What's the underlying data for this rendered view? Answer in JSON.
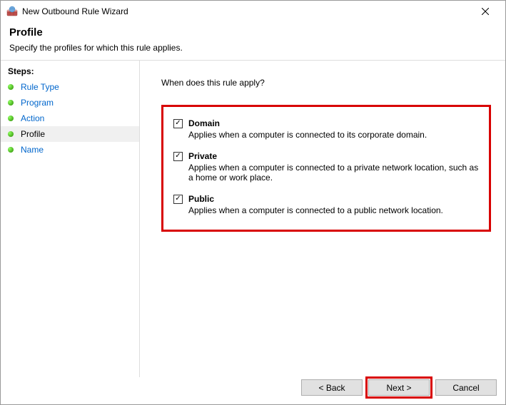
{
  "window": {
    "title": "New Outbound Rule Wizard"
  },
  "header": {
    "title": "Profile",
    "description": "Specify the profiles for which this rule applies."
  },
  "sidebar": {
    "title": "Steps:",
    "steps": [
      {
        "label": "Rule Type",
        "current": false
      },
      {
        "label": "Program",
        "current": false
      },
      {
        "label": "Action",
        "current": false
      },
      {
        "label": "Profile",
        "current": true
      },
      {
        "label": "Name",
        "current": false
      }
    ]
  },
  "content": {
    "question": "When does this rule apply?",
    "profiles": [
      {
        "label": "Domain",
        "checked": true,
        "desc": "Applies when a computer is connected to its corporate domain."
      },
      {
        "label": "Private",
        "checked": true,
        "desc": "Applies when a computer is connected to a private network location, such as a home or work place."
      },
      {
        "label": "Public",
        "checked": true,
        "desc": "Applies when a computer is connected to a public network location."
      }
    ]
  },
  "buttons": {
    "back": "< Back",
    "next": "Next >",
    "cancel": "Cancel"
  }
}
